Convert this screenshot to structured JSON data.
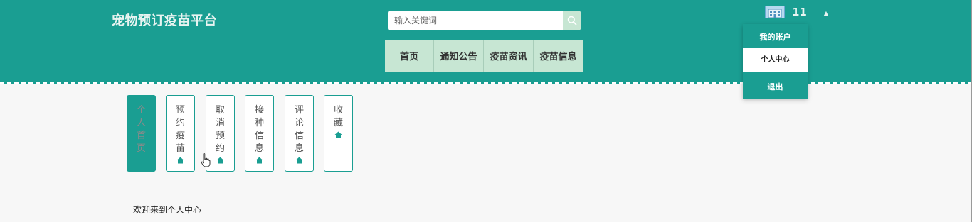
{
  "header": {
    "logo": "宠物预订疫苗平台",
    "search": {
      "placeholder": "输入关键词",
      "value": "",
      "icon": "search-icon"
    },
    "nav": [
      {
        "label": "首页",
        "width": 68
      },
      {
        "label": "通知公告",
        "width": 69
      },
      {
        "label": "疫苗资讯",
        "width": 69
      },
      {
        "label": "疫苗信息",
        "width": 69
      }
    ],
    "user": {
      "name": "11",
      "avatar": "avatar-icon",
      "caret": "▲"
    }
  },
  "dropdown": {
    "title": "我的账户",
    "items": [
      {
        "label": "个人中心",
        "active": true
      },
      {
        "label": "退出",
        "active": false
      }
    ]
  },
  "tabs": [
    {
      "label": "个人首页",
      "active": true,
      "icon": null
    },
    {
      "label": "预约疫苗",
      "active": false,
      "icon": "home-icon"
    },
    {
      "label": "取消预约",
      "active": false,
      "icon": "home-icon"
    },
    {
      "label": "接种信息",
      "active": false,
      "icon": "home-icon"
    },
    {
      "label": "评论信息",
      "active": false,
      "icon": "home-icon"
    },
    {
      "label": "收藏",
      "active": false,
      "icon": "home-icon"
    }
  ],
  "main": {
    "welcome": "欢迎来到个人中心"
  },
  "colors": {
    "primary": "#1a9e92",
    "nav_bg": "#c7e6d3",
    "page_bg": "#f7f7f7"
  }
}
